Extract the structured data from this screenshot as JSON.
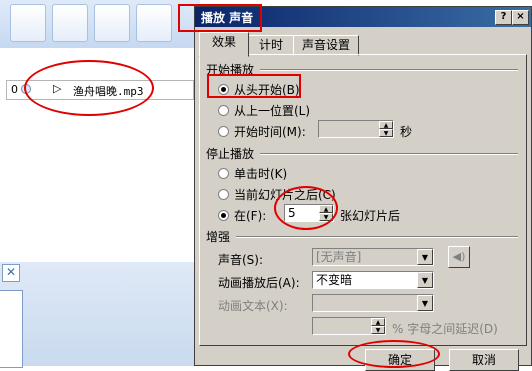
{
  "background": {
    "animation_item": {
      "number": "0",
      "play_glyph": "▷",
      "filename": "渔舟唱晚.mp3"
    },
    "close_glyph": "✕"
  },
  "dialog": {
    "title": "播放 声音",
    "help_glyph": "?",
    "close_glyph": "×",
    "tabs": [
      {
        "label": "效果",
        "active": true
      },
      {
        "label": "计时",
        "active": false
      },
      {
        "label": "声音设置",
        "active": false
      }
    ],
    "start_group": {
      "label": "开始播放",
      "options": [
        {
          "label": "从头开始(B)",
          "selected": true
        },
        {
          "label": "从上一位置(L)",
          "selected": false
        },
        {
          "label": "开始时间(M):",
          "selected": false
        }
      ],
      "time_unit": "秒",
      "time_value": ""
    },
    "stop_group": {
      "label": "停止播放",
      "options": [
        {
          "label": "单击时(K)",
          "selected": false
        },
        {
          "label": "当前幻灯片之后(C)",
          "selected": false
        },
        {
          "label": "在(F):",
          "selected": true
        }
      ],
      "slides_value": "5",
      "slides_suffix": "张幻灯片后"
    },
    "enhance_group": {
      "label": "增强",
      "sound_label": "声音(S):",
      "sound_value": "[无声音]",
      "after_anim_label": "动画播放后(A):",
      "after_anim_value": "不变暗",
      "anim_text_label": "动画文本(X):",
      "anim_text_value": "",
      "delay_value": "",
      "delay_suffix": "% 字母之间延迟(D)"
    },
    "ok_label": "确定",
    "cancel_label": "取消"
  },
  "colors": {
    "annotation_red": "#e00000",
    "title_bar": "#0a246a"
  }
}
